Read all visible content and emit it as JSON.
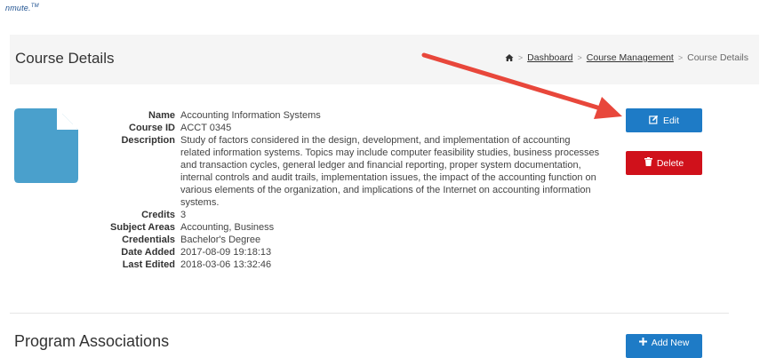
{
  "logo": {
    "text": "nmute.",
    "mark": "TM"
  },
  "header": {
    "title": "Course Details",
    "breadcrumb": {
      "home_icon": "home-icon",
      "items": [
        "Dashboard",
        "Course Management"
      ],
      "current": "Course Details"
    }
  },
  "course": {
    "icon": "document-icon",
    "fields": [
      {
        "label": "Name",
        "value": "Accounting Information Systems"
      },
      {
        "label": "Course ID",
        "value": "ACCT 0345"
      },
      {
        "label": "Description",
        "value": "Study of factors considered in the design, development, and implementation of accounting related information systems. Topics may include computer feasibility studies, business processes and transaction cycles, general ledger and financial reporting, proper system documentation, internal controls and audit trails, implementation issues, the impact of the accounting function on various elements of the organization, and implications of the Internet on accounting information systems."
      },
      {
        "label": "Credits",
        "value": "3"
      },
      {
        "label": "Subject Areas",
        "value": "Accounting, Business"
      },
      {
        "label": "Credentials",
        "value": "Bachelor's Degree"
      },
      {
        "label": "Date Added",
        "value": "2017-08-09 19:18:13"
      },
      {
        "label": "Last Edited",
        "value": "2018-03-06 13:32:46"
      }
    ]
  },
  "actions": {
    "edit_label": "Edit",
    "delete_label": "Delete"
  },
  "program_associations": {
    "title": "Program Associations",
    "add_label": "Add New"
  },
  "colors": {
    "primary": "#1e7bc6",
    "danger": "#d0111b",
    "annotation_arrow": "#e8473b",
    "doc_icon": "#4aa0cc"
  }
}
